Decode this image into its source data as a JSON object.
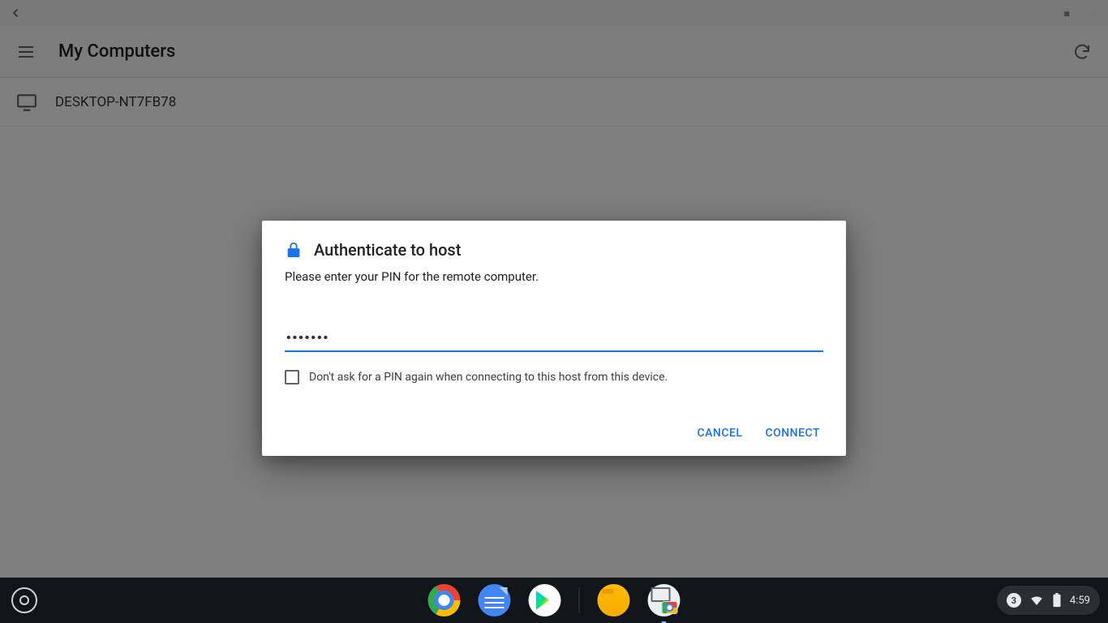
{
  "titlebar": {},
  "header": {
    "title": "My Computers"
  },
  "hosts": [
    {
      "name": "DESKTOP-NT7FB78"
    }
  ],
  "dialog": {
    "title": "Authenticate to host",
    "message": "Please enter your PIN for the remote computer.",
    "pin_value": "•••••••",
    "remember_label": "Don't ask for a PIN again when connecting to this host from this device.",
    "cancel_label": "CANCEL",
    "connect_label": "CONNECT"
  },
  "shelf": {
    "notification_count": "3",
    "clock": "4:59"
  }
}
